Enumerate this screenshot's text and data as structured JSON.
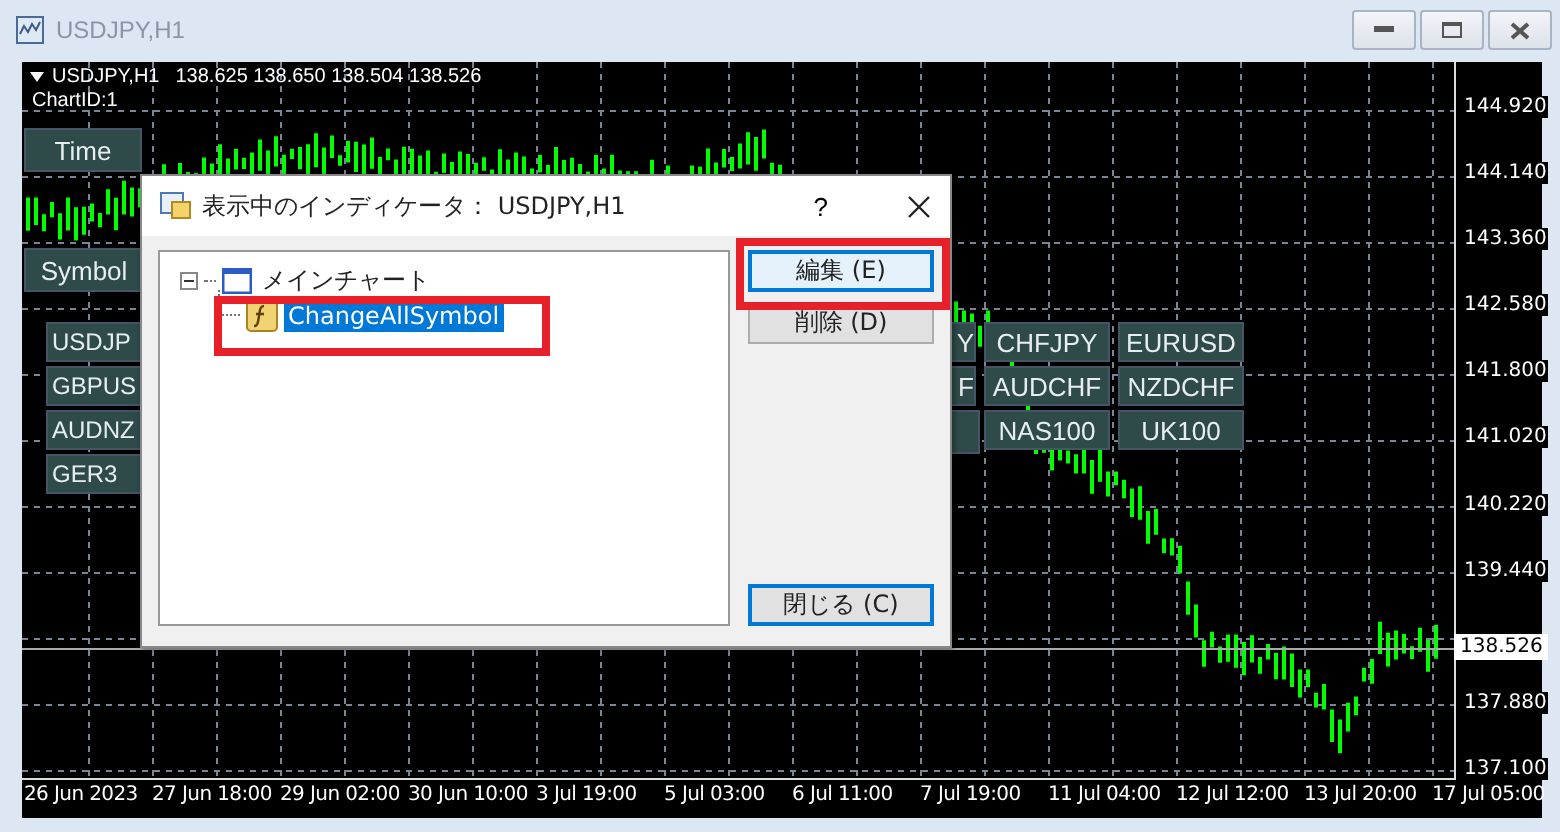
{
  "window": {
    "title": "USDJPY,H1"
  },
  "chart": {
    "header": "USDJPY,H1",
    "quote": "138.625 138.650 138.504 138.526",
    "chart_id": "ChartID:1",
    "current_price": "138.526",
    "price_labels": [
      "144.920",
      "144.140",
      "143.360",
      "142.580",
      "141.800",
      "141.020",
      "140.220",
      "139.440",
      "137.880",
      "137.100"
    ],
    "time_labels": [
      "26 Jun 2023",
      "27 Jun 18:00",
      "29 Jun 02:00",
      "30 Jun 10:00",
      "3 Jul 19:00",
      "5 Jul 03:00",
      "6 Jul 11:00",
      "7 Jul 19:00",
      "11 Jul 04:00",
      "12 Jul 12:00",
      "13 Jul 20:00",
      "17 Jul 05:00"
    ]
  },
  "panel": {
    "time_button": "Time",
    "symbol_button": "Symbol",
    "symbols_left": [
      "USDJP",
      "GBPUS",
      "AUDNZ",
      "GER3"
    ],
    "symbol_rows": [
      {
        "partial": "Y",
        "cells": [
          "CHFJPY",
          "EURUSD"
        ]
      },
      {
        "partial": "F",
        "cells": [
          "AUDCHF",
          "NZDCHF"
        ]
      },
      {
        "cells": [
          "NAS100",
          "UK100"
        ]
      }
    ]
  },
  "dialog": {
    "title": "表示中のインディケータ： USDJPY,H1",
    "help": "?",
    "tree": [
      {
        "label": "メインチャート",
        "selected": false,
        "expanded": true,
        "children": [
          {
            "label": "ChangeAllSymbol",
            "selected": true
          }
        ]
      }
    ],
    "buttons": [
      {
        "label": "編集 (E)",
        "focused": true
      },
      {
        "label": "削除 (D)",
        "focused": false
      },
      {
        "label": "閉じる (C)",
        "focused": true
      }
    ]
  }
}
